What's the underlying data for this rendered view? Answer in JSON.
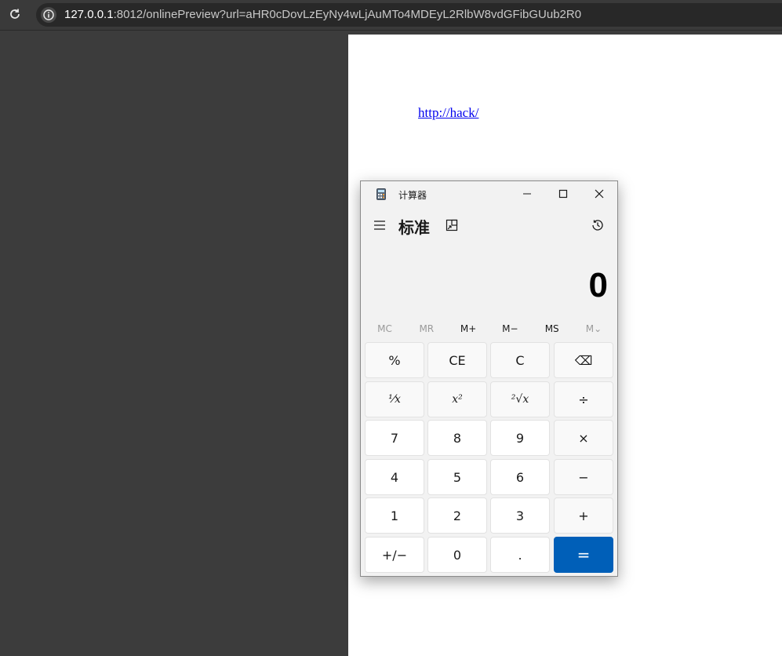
{
  "browser": {
    "url_host": "127.0.0.1",
    "url_rest": ":8012/onlinePreview?url=aHR0cDovLzEyNy4wLjAuMTo4MDEyL2RlbW8vdGFibGUub2R0"
  },
  "page": {
    "link_text": "http://hack/"
  },
  "calculator": {
    "window_title": "计算器",
    "mode_title": "标准",
    "display_value": "0",
    "memory": [
      "MC",
      "MR",
      "M+",
      "M−",
      "MS",
      "M⌄"
    ],
    "memory_disabled": [
      true,
      true,
      false,
      false,
      false,
      true
    ],
    "keys": [
      [
        "%",
        "CE",
        "C",
        "⌫"
      ],
      [
        "⅟x",
        "x²",
        "²√x",
        "÷"
      ],
      [
        "7",
        "8",
        "9",
        "×"
      ],
      [
        "4",
        "5",
        "6",
        "−"
      ],
      [
        "1",
        "2",
        "3",
        "+"
      ],
      [
        "+/−",
        "0",
        ".",
        "="
      ]
    ],
    "colors": {
      "accent": "#005fb8"
    }
  }
}
